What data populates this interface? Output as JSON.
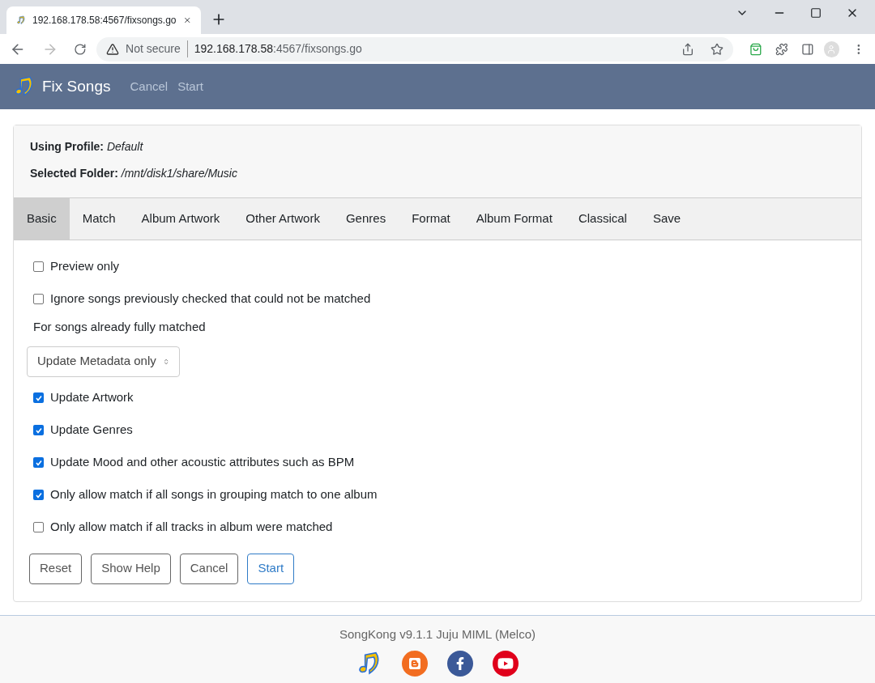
{
  "browser": {
    "tab_title": "192.168.178.58:4567/fixsongs.go",
    "security": "Not secure",
    "url_host": "192.168.178.58",
    "url_rest": ":4567/fixsongs.go"
  },
  "navbar": {
    "brand": "Fix Songs",
    "links": [
      "Cancel",
      "Start"
    ]
  },
  "header": [
    {
      "label": "Using Profile:",
      "value": "Default"
    },
    {
      "label": "Selected Folder:",
      "value": "/mnt/disk1/share/Music"
    }
  ],
  "tabs": [
    {
      "label": "Basic",
      "selected": true
    },
    {
      "label": "Match",
      "selected": false
    },
    {
      "label": "Album Artwork",
      "selected": false
    },
    {
      "label": "Other Artwork",
      "selected": false
    },
    {
      "label": "Genres",
      "selected": false
    },
    {
      "label": "Format",
      "selected": false
    },
    {
      "label": "Album Format",
      "selected": false
    },
    {
      "label": "Classical",
      "selected": false
    },
    {
      "label": "Save",
      "selected": false
    }
  ],
  "options": [
    {
      "kind": "checkbox",
      "label": "Preview only",
      "checked": false
    },
    {
      "kind": "checkbox",
      "label": "Ignore songs previously checked that could not be matched",
      "checked": false
    },
    {
      "kind": "select",
      "label": "For songs already fully matched",
      "value": "Update Metadata only"
    },
    {
      "kind": "checkbox",
      "label": "Update Artwork",
      "checked": true
    },
    {
      "kind": "checkbox",
      "label": "Update Genres",
      "checked": true
    },
    {
      "kind": "checkbox",
      "label": "Update Mood and other acoustic attributes such as BPM",
      "checked": true
    },
    {
      "kind": "checkbox",
      "label": "Only allow match if all songs in grouping match to one album",
      "checked": true
    },
    {
      "kind": "checkbox",
      "label": "Only allow match if all tracks in album were matched",
      "checked": false
    }
  ],
  "buttons": [
    {
      "label": "Reset",
      "primary": false
    },
    {
      "label": "Show Help",
      "primary": false
    },
    {
      "label": "Cancel",
      "primary": false
    },
    {
      "label": "Start",
      "primary": true
    }
  ],
  "footer": {
    "version": "SongKong v9.1.1 Juju MIML (Melco)"
  }
}
